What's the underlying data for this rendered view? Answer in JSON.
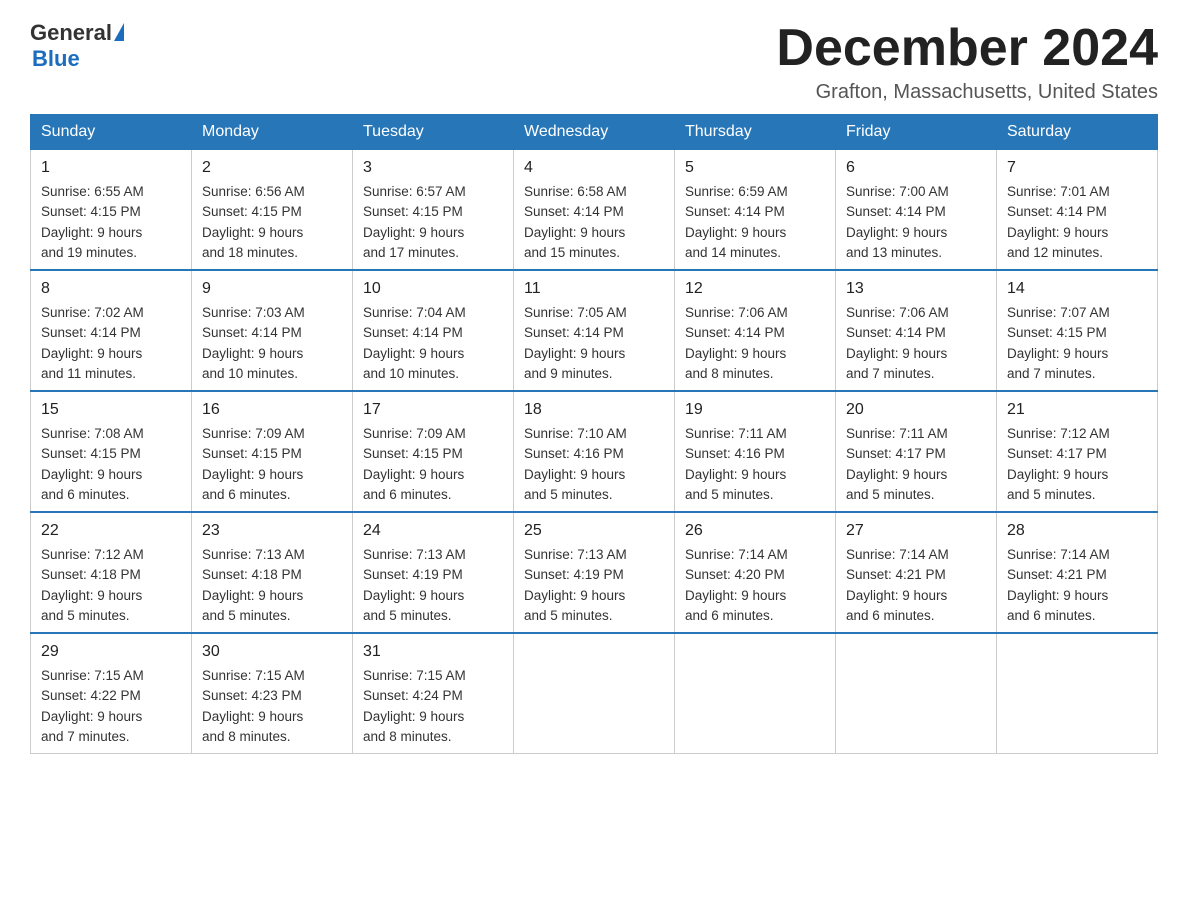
{
  "header": {
    "logo_general": "General",
    "logo_blue": "Blue",
    "month_title": "December 2024",
    "location": "Grafton, Massachusetts, United States"
  },
  "weekdays": [
    "Sunday",
    "Monday",
    "Tuesday",
    "Wednesday",
    "Thursday",
    "Friday",
    "Saturday"
  ],
  "weeks": [
    [
      {
        "day": "1",
        "sunrise": "6:55 AM",
        "sunset": "4:15 PM",
        "daylight": "9 hours and 19 minutes."
      },
      {
        "day": "2",
        "sunrise": "6:56 AM",
        "sunset": "4:15 PM",
        "daylight": "9 hours and 18 minutes."
      },
      {
        "day": "3",
        "sunrise": "6:57 AM",
        "sunset": "4:15 PM",
        "daylight": "9 hours and 17 minutes."
      },
      {
        "day": "4",
        "sunrise": "6:58 AM",
        "sunset": "4:14 PM",
        "daylight": "9 hours and 15 minutes."
      },
      {
        "day": "5",
        "sunrise": "6:59 AM",
        "sunset": "4:14 PM",
        "daylight": "9 hours and 14 minutes."
      },
      {
        "day": "6",
        "sunrise": "7:00 AM",
        "sunset": "4:14 PM",
        "daylight": "9 hours and 13 minutes."
      },
      {
        "day": "7",
        "sunrise": "7:01 AM",
        "sunset": "4:14 PM",
        "daylight": "9 hours and 12 minutes."
      }
    ],
    [
      {
        "day": "8",
        "sunrise": "7:02 AM",
        "sunset": "4:14 PM",
        "daylight": "9 hours and 11 minutes."
      },
      {
        "day": "9",
        "sunrise": "7:03 AM",
        "sunset": "4:14 PM",
        "daylight": "9 hours and 10 minutes."
      },
      {
        "day": "10",
        "sunrise": "7:04 AM",
        "sunset": "4:14 PM",
        "daylight": "9 hours and 10 minutes."
      },
      {
        "day": "11",
        "sunrise": "7:05 AM",
        "sunset": "4:14 PM",
        "daylight": "9 hours and 9 minutes."
      },
      {
        "day": "12",
        "sunrise": "7:06 AM",
        "sunset": "4:14 PM",
        "daylight": "9 hours and 8 minutes."
      },
      {
        "day": "13",
        "sunrise": "7:06 AM",
        "sunset": "4:14 PM",
        "daylight": "9 hours and 7 minutes."
      },
      {
        "day": "14",
        "sunrise": "7:07 AM",
        "sunset": "4:15 PM",
        "daylight": "9 hours and 7 minutes."
      }
    ],
    [
      {
        "day": "15",
        "sunrise": "7:08 AM",
        "sunset": "4:15 PM",
        "daylight": "9 hours and 6 minutes."
      },
      {
        "day": "16",
        "sunrise": "7:09 AM",
        "sunset": "4:15 PM",
        "daylight": "9 hours and 6 minutes."
      },
      {
        "day": "17",
        "sunrise": "7:09 AM",
        "sunset": "4:15 PM",
        "daylight": "9 hours and 6 minutes."
      },
      {
        "day": "18",
        "sunrise": "7:10 AM",
        "sunset": "4:16 PM",
        "daylight": "9 hours and 5 minutes."
      },
      {
        "day": "19",
        "sunrise": "7:11 AM",
        "sunset": "4:16 PM",
        "daylight": "9 hours and 5 minutes."
      },
      {
        "day": "20",
        "sunrise": "7:11 AM",
        "sunset": "4:17 PM",
        "daylight": "9 hours and 5 minutes."
      },
      {
        "day": "21",
        "sunrise": "7:12 AM",
        "sunset": "4:17 PM",
        "daylight": "9 hours and 5 minutes."
      }
    ],
    [
      {
        "day": "22",
        "sunrise": "7:12 AM",
        "sunset": "4:18 PM",
        "daylight": "9 hours and 5 minutes."
      },
      {
        "day": "23",
        "sunrise": "7:13 AM",
        "sunset": "4:18 PM",
        "daylight": "9 hours and 5 minutes."
      },
      {
        "day": "24",
        "sunrise": "7:13 AM",
        "sunset": "4:19 PM",
        "daylight": "9 hours and 5 minutes."
      },
      {
        "day": "25",
        "sunrise": "7:13 AM",
        "sunset": "4:19 PM",
        "daylight": "9 hours and 5 minutes."
      },
      {
        "day": "26",
        "sunrise": "7:14 AM",
        "sunset": "4:20 PM",
        "daylight": "9 hours and 6 minutes."
      },
      {
        "day": "27",
        "sunrise": "7:14 AM",
        "sunset": "4:21 PM",
        "daylight": "9 hours and 6 minutes."
      },
      {
        "day": "28",
        "sunrise": "7:14 AM",
        "sunset": "4:21 PM",
        "daylight": "9 hours and 6 minutes."
      }
    ],
    [
      {
        "day": "29",
        "sunrise": "7:15 AM",
        "sunset": "4:22 PM",
        "daylight": "9 hours and 7 minutes."
      },
      {
        "day": "30",
        "sunrise": "7:15 AM",
        "sunset": "4:23 PM",
        "daylight": "9 hours and 8 minutes."
      },
      {
        "day": "31",
        "sunrise": "7:15 AM",
        "sunset": "4:24 PM",
        "daylight": "9 hours and 8 minutes."
      },
      null,
      null,
      null,
      null
    ]
  ],
  "labels": {
    "sunrise": "Sunrise:",
    "sunset": "Sunset:",
    "daylight": "Daylight:"
  }
}
